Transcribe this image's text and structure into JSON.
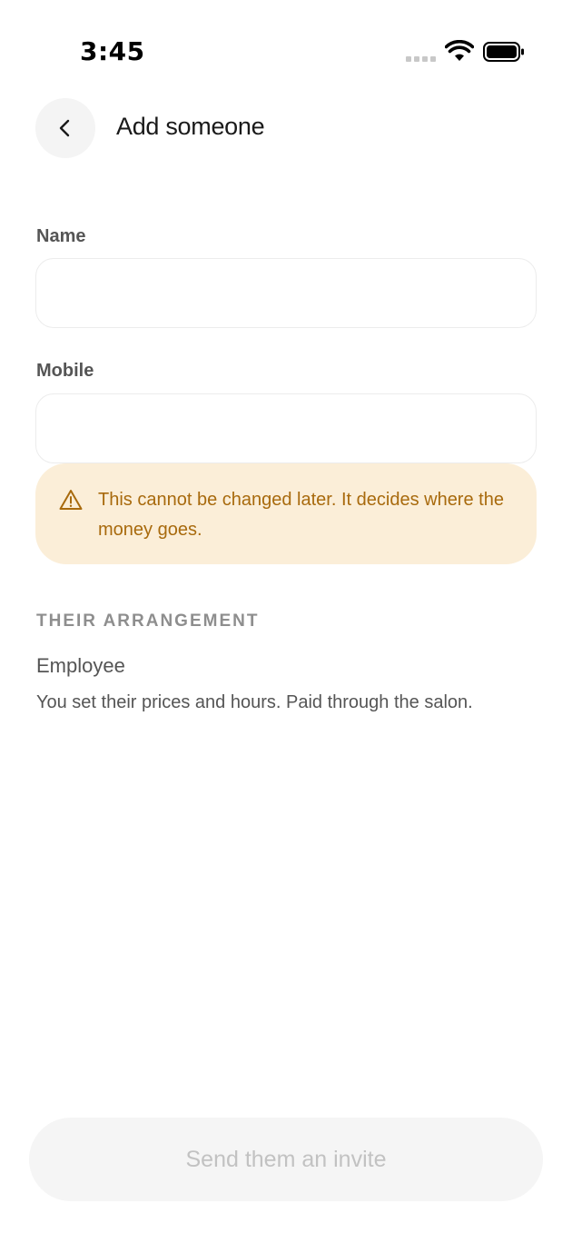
{
  "status_bar": {
    "time": "3:45"
  },
  "header": {
    "title": "Add someone",
    "back_icon": "chevron-left-icon"
  },
  "form": {
    "name_label": "Name",
    "name_value": "",
    "mobile_label": "Mobile",
    "mobile_value": ""
  },
  "warning": {
    "icon": "warning-triangle-icon",
    "text": "This cannot be changed later. It decides where the money goes.",
    "color": "#a86a0d",
    "background": "#fbeed8"
  },
  "arrangement": {
    "heading": "THEIR ARRANGEMENT",
    "title": "Employee",
    "description": "You set their prices and hours. Paid through the salon."
  },
  "cta": {
    "label": "Send them an invite",
    "enabled": false
  }
}
